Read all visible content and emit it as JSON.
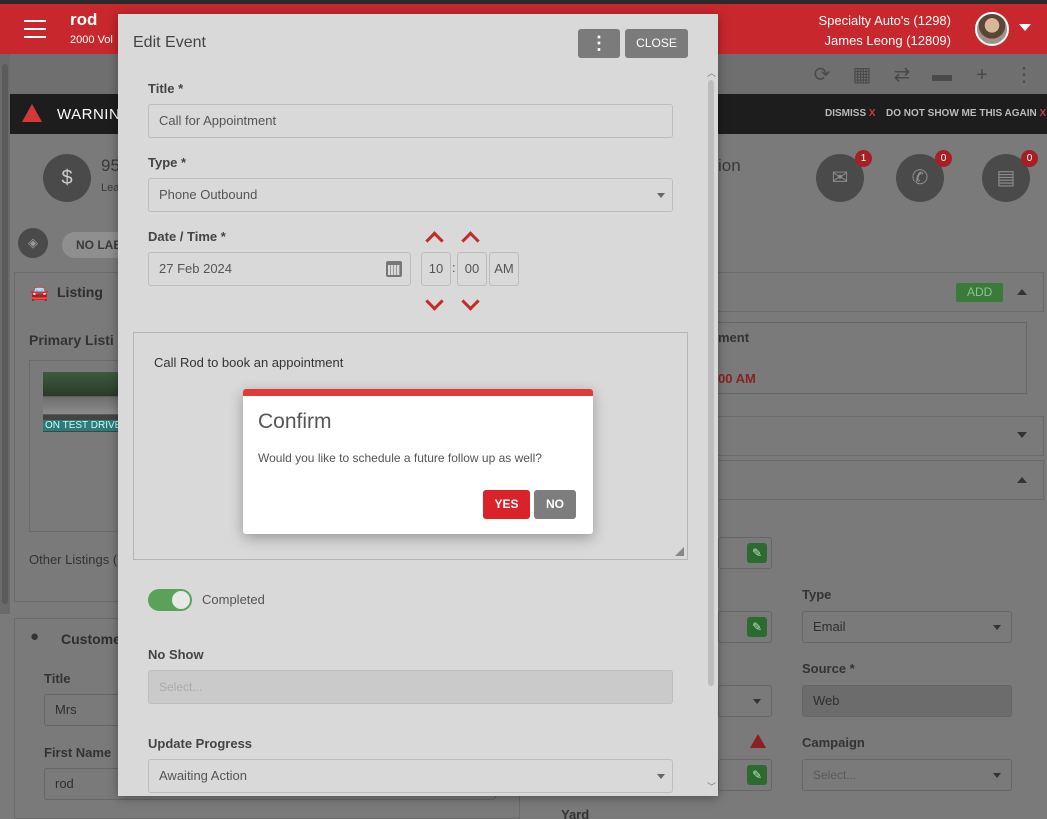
{
  "app": {
    "user_name": "rod",
    "vehicle_sub": "2000 Vol",
    "dealer": "Specialty Auto's (1298)",
    "staff": "James Leong (12809)"
  },
  "warning": {
    "label": "WARNING",
    "dismiss": "DISMISS",
    "dont_show": "DO NOT SHOW ME THIS AGAIN",
    "x": "X"
  },
  "background": {
    "stat_value": "95",
    "stat_sub": "Lea",
    "heading_tail": "ion",
    "badges": {
      "email": "1",
      "phone": "0",
      "chat": "0"
    },
    "no_label": "NO LAB",
    "listing_title": "Listing",
    "primary_listing": "Primary Listi",
    "car_status": "ON TEST DRIVE",
    "other_listings": "Other Listings (",
    "add": "ADD",
    "ment_label": "ment",
    "ment_time": "00 AM",
    "customer_title": "Custome",
    "title_label": "Title",
    "title_value": "Mrs",
    "first_name_label": "First Name",
    "first_name_value": "rod",
    "type_label": "Type",
    "type_value": "Email",
    "source_label": "Source *",
    "source_value": "Web",
    "campaign_label": "Campaign",
    "campaign_placeholder": "Select...",
    "yard_label": "Yard"
  },
  "modal": {
    "title": "Edit Event",
    "menu": "⋮",
    "close": "CLOSE",
    "title_label": "Title *",
    "title_value": "Call for Appointment",
    "type_label": "Type *",
    "type_value": "Phone Outbound",
    "datetime_label": "Date / Time *",
    "date_value": "27 Feb 2024",
    "hour": "10",
    "minute": "00",
    "ampm": "AM",
    "colon": ":",
    "description": "Call Rod to book an appointment",
    "completed_label": "Completed",
    "noshow_label": "No Show",
    "noshow_placeholder": "Select...",
    "progress_label": "Update Progress",
    "progress_value": "Awaiting Action"
  },
  "confirm": {
    "title": "Confirm",
    "message": "Would you like to schedule a future follow up as well?",
    "yes": "YES",
    "no": "NO"
  },
  "colors": {
    "brand_red": "#c8272e",
    "confirm_accent": "#e03a3a",
    "toggle_on": "#5aa15a"
  }
}
